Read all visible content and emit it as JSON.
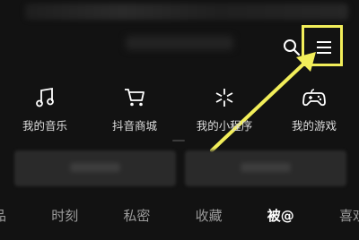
{
  "header": {
    "icons": [
      "search-icon",
      "hamburger-menu-icon"
    ]
  },
  "annotation": {
    "color": "#f2ee5a"
  },
  "shortcuts": [
    {
      "label": "我的音乐",
      "icon": "music-note-icon"
    },
    {
      "label": "抖音商城",
      "icon": "shopping-cart-icon"
    },
    {
      "label": "我的小程序",
      "icon": "asterisk-icon"
    },
    {
      "label": "我的游戏",
      "icon": "gamepad-icon"
    }
  ],
  "tabs": [
    {
      "label": "品",
      "active": false
    },
    {
      "label": "时刻",
      "active": false
    },
    {
      "label": "私密",
      "active": false
    },
    {
      "label": "收藏",
      "active": false
    },
    {
      "label": "被@",
      "active": true
    },
    {
      "label": "喜欢",
      "active": false
    }
  ]
}
